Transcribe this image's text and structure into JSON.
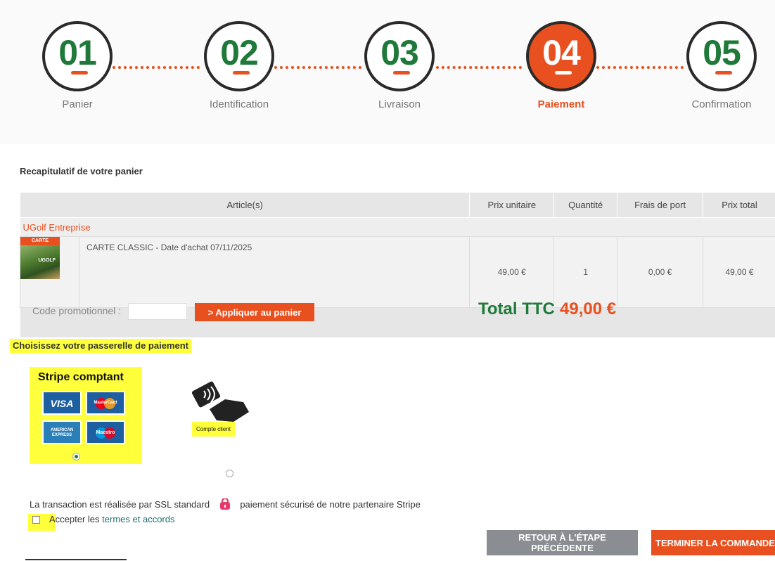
{
  "stepper": {
    "steps": [
      {
        "number": "01",
        "label": "Panier",
        "active": false
      },
      {
        "number": "02",
        "label": "Identification",
        "active": false
      },
      {
        "number": "03",
        "label": "Livraison",
        "active": false
      },
      {
        "number": "04",
        "label": "Paiement",
        "active": true
      },
      {
        "number": "05",
        "label": "Confirmation",
        "active": false
      }
    ]
  },
  "cart": {
    "title": "Recapitulatif de votre panier",
    "headers": {
      "article": "Article(s)",
      "unit_price": "Prix unitaire",
      "quantity": "Quantité",
      "shipping": "Frais de port",
      "total": "Prix total"
    },
    "vendor": "UGolf Entreprise",
    "item": {
      "thumb_band": "CARTE CLASSIC",
      "thumb_logo": "UGOLF",
      "description": "CARTE CLASSIC - Date d'achat 07/11/2025",
      "unit_price": "49,00 €",
      "quantity": "1",
      "shipping": "0,00 €",
      "total": "49,00 €"
    },
    "promo": {
      "label": "Code promotionnel :",
      "input_value": "",
      "apply_label": "> Appliquer au panier"
    },
    "total_label": "Total TTC",
    "total_value": "49,00 €"
  },
  "payment": {
    "title": "Choisissez votre passerelle de paiement",
    "stripe": {
      "title": "Stripe comptant",
      "cards": [
        "VISA",
        "MasterCard",
        "AMERICAN EXPRESS",
        "Maestro"
      ],
      "selected": true
    },
    "account": {
      "label": "Compte client",
      "selected": false
    },
    "ssl_text_before": "La transaction est réalisée par SSL standard",
    "ssl_text_after": "paiement sécurisé de notre partenaire Stripe",
    "accept_prefix": "Accepter les",
    "accept_link": "termes et accords",
    "accept_checked": false
  },
  "actions": {
    "back_label": "RETOUR À L'ÉTAPE PRÉCÉDENTE",
    "finish_label": "TERMINER LA COMMANDE"
  },
  "colors": {
    "accent_orange": "#e8501f",
    "accent_green": "#1f7a3a",
    "highlight_yellow": "#ffff3c",
    "button_grey": "#8a8d91"
  }
}
